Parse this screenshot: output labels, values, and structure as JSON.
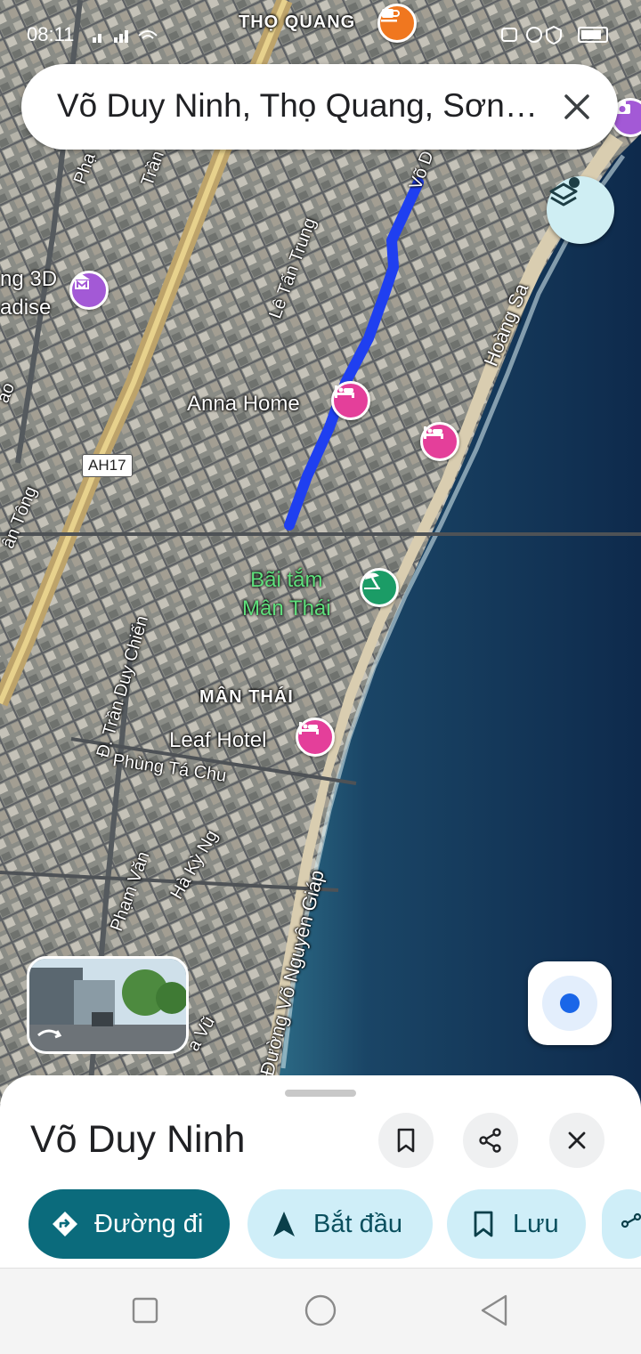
{
  "status_bar": {
    "time": "08:11"
  },
  "search": {
    "query": "Võ Duy Ninh, Thọ Quang, Sơn Trà, Đà Nẵng"
  },
  "map": {
    "labels": {
      "tho_quang": "THỌ QUANG",
      "anna_home": "Anna Home",
      "bai_tam": "Bãi tắm\nMân Thái",
      "man_thai": "MÂN THÁI",
      "leaf_hotel": "Leaf Hotel",
      "le_tan_trung": "Lê Tấn Trung",
      "hoang_sa": "Hoàng Sa",
      "vo_d": "Võ D",
      "route_ah17": "AH17",
      "ng_3d": "ng 3D",
      "adise": "adise",
      "phan": "Phạ",
      "tran": "Trần",
      "an_tong": "ân Tông",
      "ao": "ao",
      "tran_duy_chien": "Đ. Trần Duy Chiến",
      "phung_ta_chu": "Phùng Tá Chu",
      "pham_van": "Phạm Văn",
      "ha_ky_ng": "Hà Kỳ Ng",
      "vo_nguyen_giap": "Đường Võ Nguyên Giáp",
      "a_vu": "a Vũ"
    },
    "colors": {
      "route": "#1f3ff0",
      "sea_dark": "#0e2a4c",
      "sea_light": "#2c6a85",
      "beach": "#d9cdb0"
    }
  },
  "sheet": {
    "title": "Võ Duy Ninh",
    "actions": {
      "directions": "Đường đi",
      "start": "Bắt đầu",
      "save": "Lưu"
    }
  }
}
